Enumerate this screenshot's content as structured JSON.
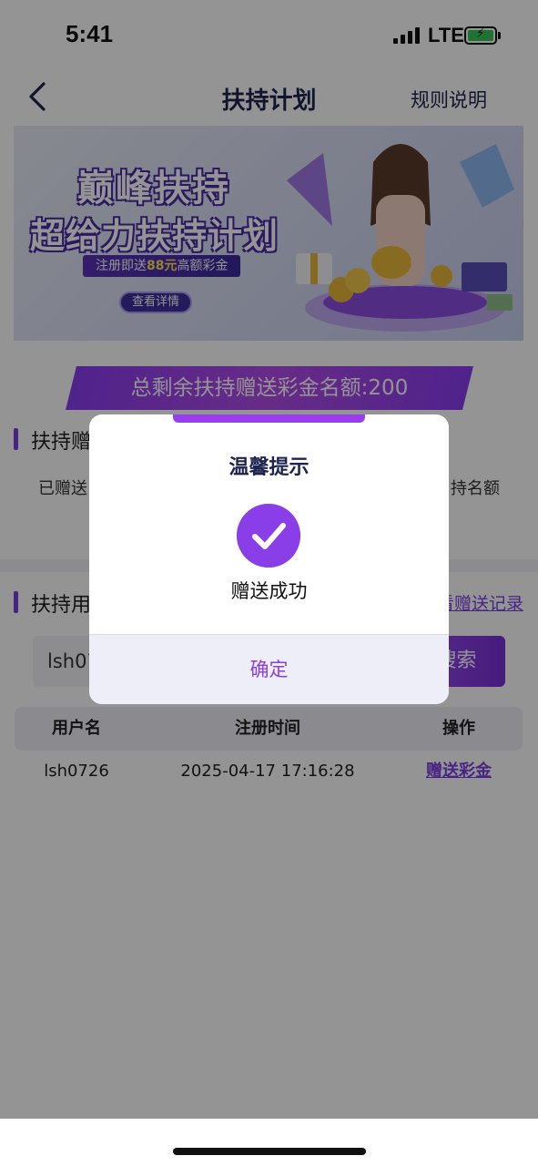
{
  "status_bar": {
    "time": "5:41",
    "network": "LTE"
  },
  "nav": {
    "title": "扶持计划",
    "rules_label": "规则说明"
  },
  "banner": {
    "title_line1": "巅峰扶持",
    "title_line2": "超给力扶持计划",
    "promo_prefix": "注册即送",
    "promo_amount": "88元",
    "promo_suffix": "高额彩金",
    "button_label": "查看详情"
  },
  "quota": {
    "text": "总剩余扶持赠送彩金名额:200"
  },
  "section1": {
    "title": "扶持赠",
    "stat_left": "已赠送",
    "stat_right": "持名额"
  },
  "section2": {
    "title": "扶持用",
    "records_link": "看赠送记录"
  },
  "search": {
    "value": "lsh07",
    "button_label": "搜索"
  },
  "table": {
    "columns": [
      "用户名",
      "注册时间",
      "操作"
    ],
    "rows": [
      {
        "username": "lsh0726",
        "registered": "2025-04-17 17:16:28",
        "action": "赠送彩金"
      }
    ]
  },
  "modal": {
    "title": "温馨提示",
    "message": "赠送成功",
    "confirm_label": "确定"
  },
  "colors": {
    "accent": "#7b3fe4",
    "title": "#1f2350"
  }
}
